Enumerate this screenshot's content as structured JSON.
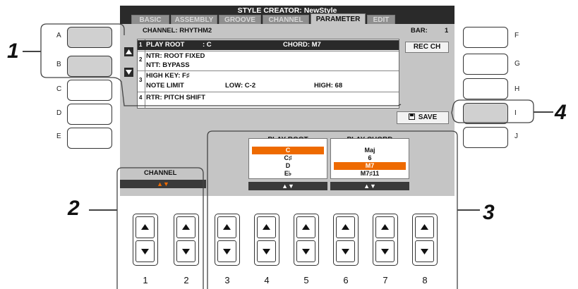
{
  "lcd": {
    "title": "STYLE CREATOR: NewStyle",
    "tabs": [
      "BASIC",
      "ASSEMBLY",
      "GROOVE",
      "CHANNEL",
      "PARAMETER",
      "EDIT"
    ],
    "channel_label": "CHANNEL: RHYTHM2",
    "bar_label": "BAR:",
    "bar_value": "1",
    "rows": [
      {
        "num": "1",
        "text": "PLAY ROOT",
        "value": ": C",
        "extra": "CHORD: M7"
      },
      {
        "num": "2",
        "text": "NTR: ROOT FIXED"
      },
      {
        "num": "",
        "text": "NTT: BYPASS"
      },
      {
        "num": "3",
        "text": "HIGH KEY: F♯"
      },
      {
        "num": "",
        "text": "NOTE LIMIT",
        "low": "LOW: C-2",
        "high": "HIGH: 68"
      },
      {
        "num": "4",
        "text": "RTR: PITCH SHIFT"
      }
    ],
    "rec_ch_label": "REC CH",
    "save_label": "SAVE",
    "channel_section_label": "CHANNEL",
    "play_root": {
      "title": "PLAY ROOT",
      "options": [
        "C",
        "C♯",
        "D",
        "E♭"
      ],
      "selected": "C"
    },
    "play_chord": {
      "title": "PLAY CHORD",
      "options": [
        "Maj",
        "6",
        "M7",
        "M7♯11"
      ],
      "selected": "M7"
    },
    "updown_glyph": "▲▼"
  },
  "left_buttons": [
    "A",
    "B",
    "C",
    "D",
    "E"
  ],
  "right_buttons": [
    "F",
    "G",
    "H",
    "I",
    "J"
  ],
  "bottom_buttons": [
    "1",
    "2",
    "3",
    "4",
    "5",
    "6",
    "7",
    "8"
  ],
  "callouts": [
    "1",
    "2",
    "3",
    "4"
  ],
  "colors": {
    "selection": "#ee6a00",
    "lcd_bg": "#c5c5c5",
    "title_bar": "#2a2a2a"
  }
}
